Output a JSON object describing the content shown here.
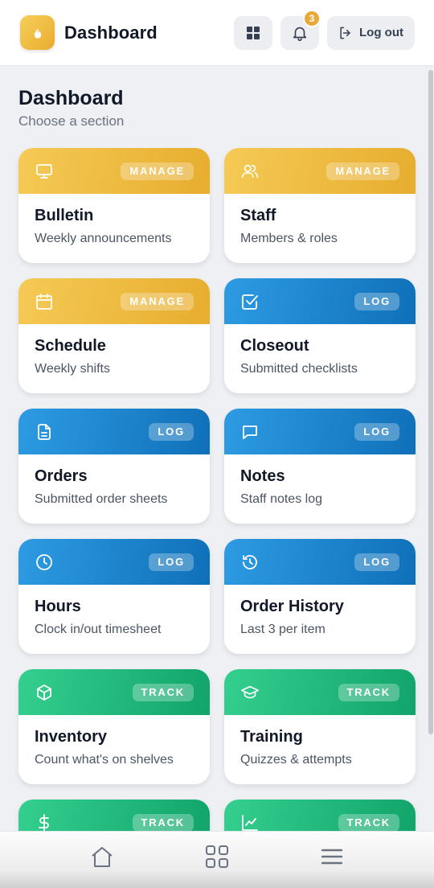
{
  "header": {
    "title": "Dashboard",
    "logo_icon": "flame-icon",
    "grid_icon": "grid-icon",
    "bell_icon": "bell-icon",
    "notification_count": "3",
    "logout_label": "Log out",
    "logout_icon": "logout-icon"
  },
  "page": {
    "heading": "Dashboard",
    "subheading": "Choose a section"
  },
  "colors": {
    "manage": "#EAB133",
    "log": "#1A82CC",
    "track": "#1FB87A",
    "badge": "#E9A83A"
  },
  "cards": [
    {
      "title": "Bulletin",
      "subtitle": "Weekly announcements",
      "tag": "MANAGE",
      "icon": "monitor-icon"
    },
    {
      "title": "Staff",
      "subtitle": "Members & roles",
      "tag": "MANAGE",
      "icon": "users-icon"
    },
    {
      "title": "Schedule",
      "subtitle": "Weekly shifts",
      "tag": "MANAGE",
      "icon": "calendar-icon"
    },
    {
      "title": "Closeout",
      "subtitle": "Submitted checklists",
      "tag": "LOG",
      "icon": "checkbox-icon"
    },
    {
      "title": "Orders",
      "subtitle": "Submitted order sheets",
      "tag": "LOG",
      "icon": "document-icon"
    },
    {
      "title": "Notes",
      "subtitle": "Staff notes log",
      "tag": "LOG",
      "icon": "message-icon"
    },
    {
      "title": "Hours",
      "subtitle": "Clock in/out timesheet",
      "tag": "LOG",
      "icon": "clock-icon"
    },
    {
      "title": "Order History",
      "subtitle": "Last 3 per item",
      "tag": "LOG",
      "icon": "history-icon"
    },
    {
      "title": "Inventory",
      "subtitle": "Count what's on shelves",
      "tag": "TRACK",
      "icon": "box-icon"
    },
    {
      "title": "Training",
      "subtitle": "Quizzes & attempts",
      "tag": "TRACK",
      "icon": "graduation-cap-icon"
    },
    {
      "title": "",
      "subtitle": "",
      "tag": "TRACK",
      "icon": "dollar-icon"
    },
    {
      "title": "",
      "subtitle": "",
      "tag": "TRACK",
      "icon": "chart-line-icon"
    }
  ],
  "bottom_nav": [
    {
      "icon": "home-icon"
    },
    {
      "icon": "apps-icon"
    },
    {
      "icon": "menu-icon"
    }
  ]
}
